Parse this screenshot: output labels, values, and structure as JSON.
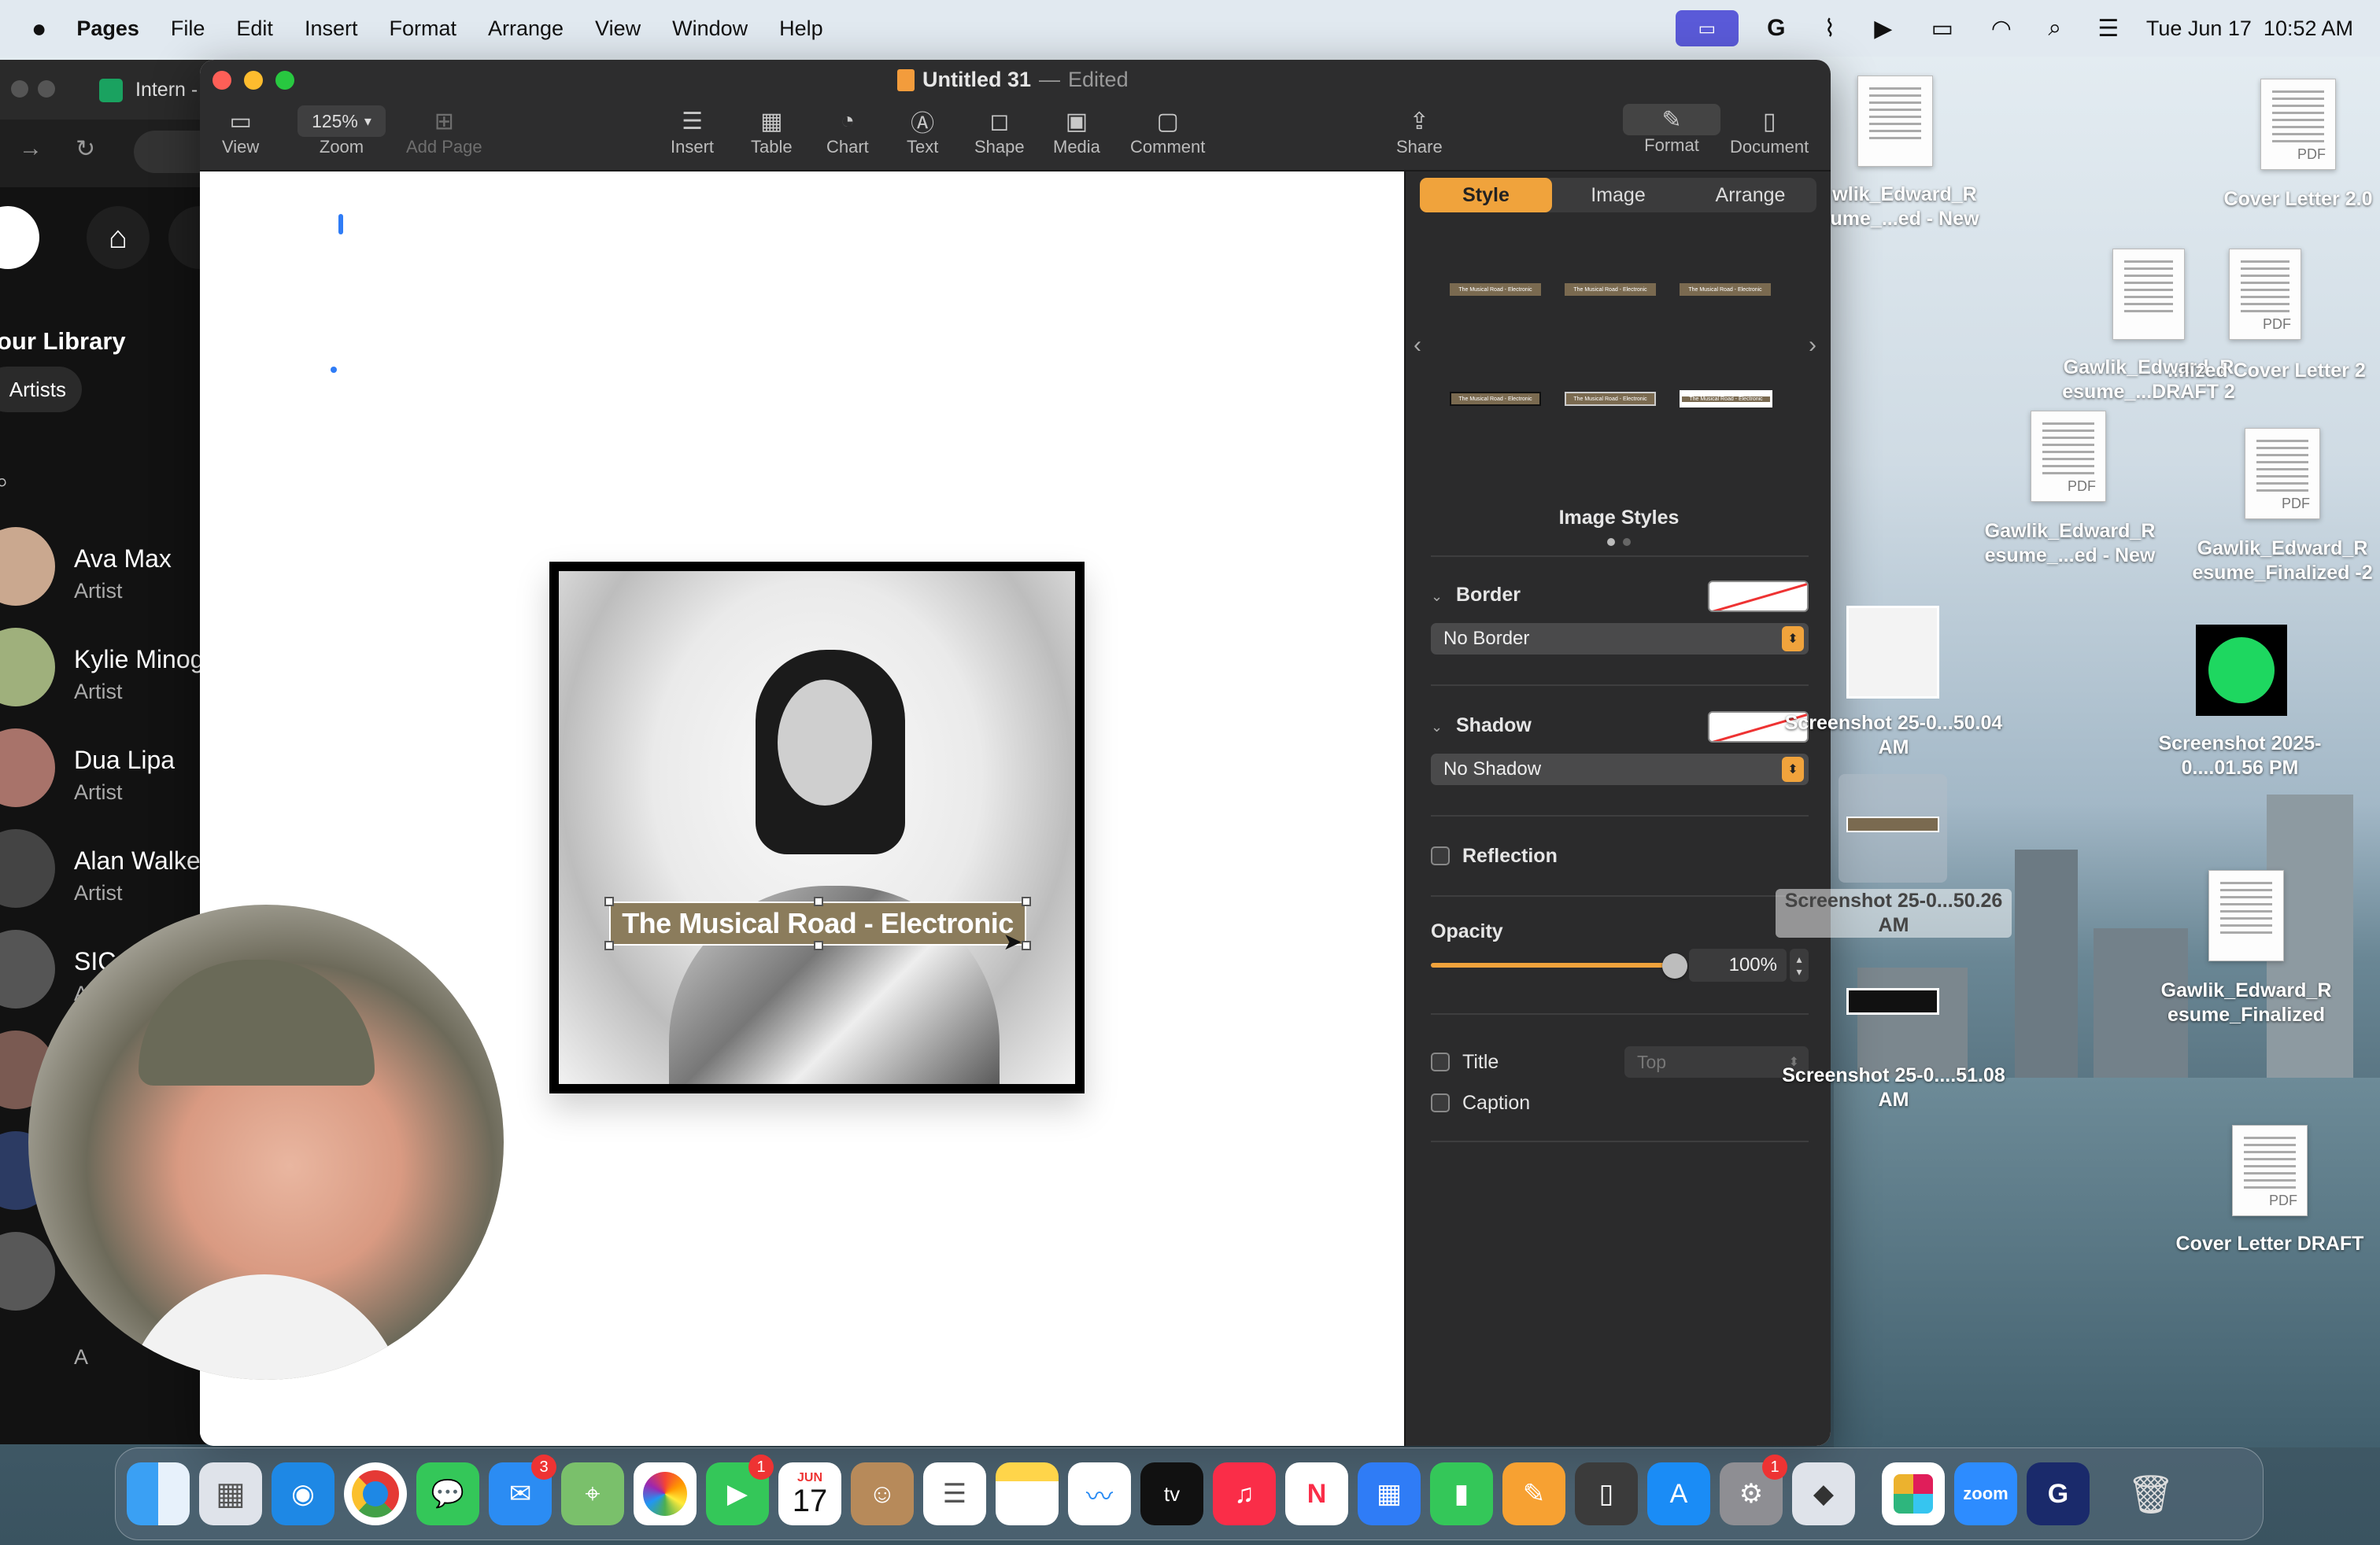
{
  "menubar": {
    "app_name": "Pages",
    "menus": [
      "File",
      "Edit",
      "Insert",
      "Format",
      "Arrange",
      "View",
      "Window",
      "Help"
    ],
    "clock": "Tue Jun 17  10:52 AM"
  },
  "spotify": {
    "tab_title": "Intern -",
    "section_title": "our Library",
    "filter_chip": "Artists",
    "artists": [
      {
        "name": "Ava Max",
        "type": "Artist"
      },
      {
        "name": "Kylie Minog",
        "type": "Artist"
      },
      {
        "name": "Dua Lipa",
        "type": "Artist"
      },
      {
        "name": "Alan Walke",
        "type": "Artist"
      },
      {
        "name": "SIC",
        "type": "A"
      },
      {
        "name": "",
        "type": "A"
      }
    ]
  },
  "pages": {
    "title": "Untitled 31",
    "title_sep": "—",
    "title_status": "Edited",
    "zoom": "125%",
    "toolbar": {
      "view": "View",
      "zoom": "Zoom",
      "add_page": "Add Page",
      "insert": "Insert",
      "table": "Table",
      "chart": "Chart",
      "text": "Text",
      "shape": "Shape",
      "media": "Media",
      "comment": "Comment",
      "share": "Share",
      "format": "Format",
      "document": "Document"
    },
    "image_caption_text": "The Musical Road - Electronic"
  },
  "inspector": {
    "tabs": {
      "style": "Style",
      "image": "Image",
      "arrange": "Arrange"
    },
    "thumb_text": "The Musical Road - Electronic",
    "image_styles_label": "Image Styles",
    "border": {
      "label": "Border",
      "value": "No Border"
    },
    "shadow": {
      "label": "Shadow",
      "value": "No Shadow"
    },
    "reflection": {
      "label": "Reflection"
    },
    "opacity": {
      "label": "Opacity",
      "value": "100%",
      "fraction": 1.0
    },
    "title": {
      "label": "Title",
      "position": "Top"
    },
    "caption": {
      "label": "Caption"
    },
    "accent": "#f0a33c"
  },
  "desktop": {
    "items": [
      {
        "label": "wlik_Edward_R ume_...ed - New"
      },
      {
        "label": "Cover Letter 2.0"
      },
      {
        "label": "Gawlik_Edward_R esume_...DRAFT 2"
      },
      {
        "label": "...lized Cover Letter 2"
      },
      {
        "label": "Gawlik_Edward_R esume_...ed - New"
      },
      {
        "label": "Gawlik_Edward_R esume_Finalized -2"
      },
      {
        "label": "Screenshot 25-0...50.04 AM"
      },
      {
        "label": "Screenshot 2025-0....01.56 PM"
      },
      {
        "label": "Screenshot 25-0...50.26 AM"
      },
      {
        "label": "Gawlik_Edward_R esume_Finalized"
      },
      {
        "label": "Screenshot 25-0....51.08 AM"
      },
      {
        "label": "Cover Letter DRAFT"
      }
    ],
    "pdf_tag": "PDF"
  },
  "dock": {
    "mail_badge": "3",
    "facetime_badge": "1",
    "calendar_month": "JUN",
    "calendar_day": "17",
    "settings_badge": "1",
    "zoom_label": "zoom",
    "tv_label": "tv"
  }
}
